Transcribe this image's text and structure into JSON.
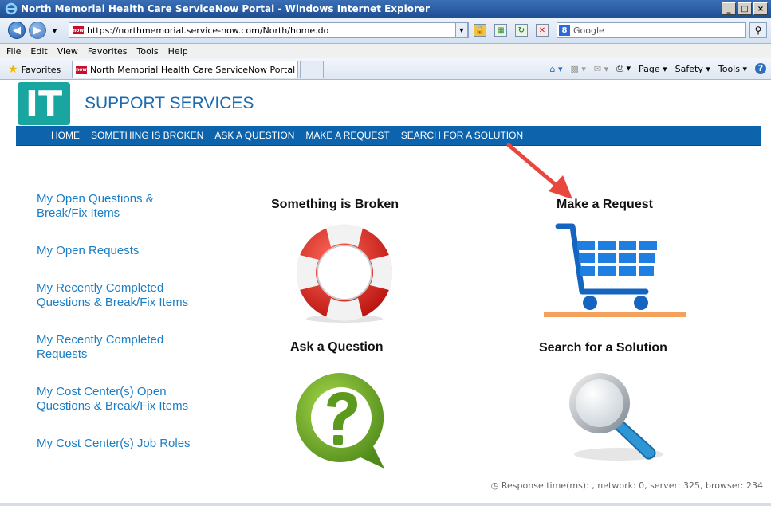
{
  "window": {
    "title": "North Memorial Health Care ServiceNow Portal - Windows Internet Explorer",
    "buttons": [
      "_",
      "□",
      "×"
    ]
  },
  "addressbar": {
    "url": "https://northmemorial.service-now.com/North/home.do",
    "search_placeholder": "Google"
  },
  "menubar": [
    "File",
    "Edit",
    "View",
    "Favorites",
    "Tools",
    "Help"
  ],
  "favorites_bar": {
    "favorites_label": "Favorites",
    "tab_title": "North Memorial Health Care ServiceNow Portal",
    "commands": [
      "Page ▾",
      "Safety ▾",
      "Tools ▾"
    ]
  },
  "site": {
    "logo_text": "IT",
    "brand": "SUPPORT SERVICES",
    "nav": [
      "HOME",
      "SOMETHING IS BROKEN",
      "ASK A QUESTION",
      "MAKE A REQUEST",
      "SEARCH FOR A SOLUTION"
    ]
  },
  "left_links": [
    "My Open Questions & Break/Fix Items",
    "My Open Requests",
    "My Recently Completed Questions & Break/Fix Items",
    "My Recently Completed Requests",
    "My Cost Center(s) Open Questions & Break/Fix Items",
    "My Cost Center(s) Job Roles"
  ],
  "tiles": {
    "broken": "Something is Broken",
    "request": "Make a Request",
    "question": "Ask a Question",
    "search": "Search for a Solution"
  },
  "status": "Response time(ms): , network: 0, server: 325, browser: 234",
  "colors": {
    "brand_blue": "#0d64ad",
    "logo_teal": "#1aa6a0",
    "link_blue": "#1a7ec6",
    "annotation_red": "#e8473e"
  }
}
